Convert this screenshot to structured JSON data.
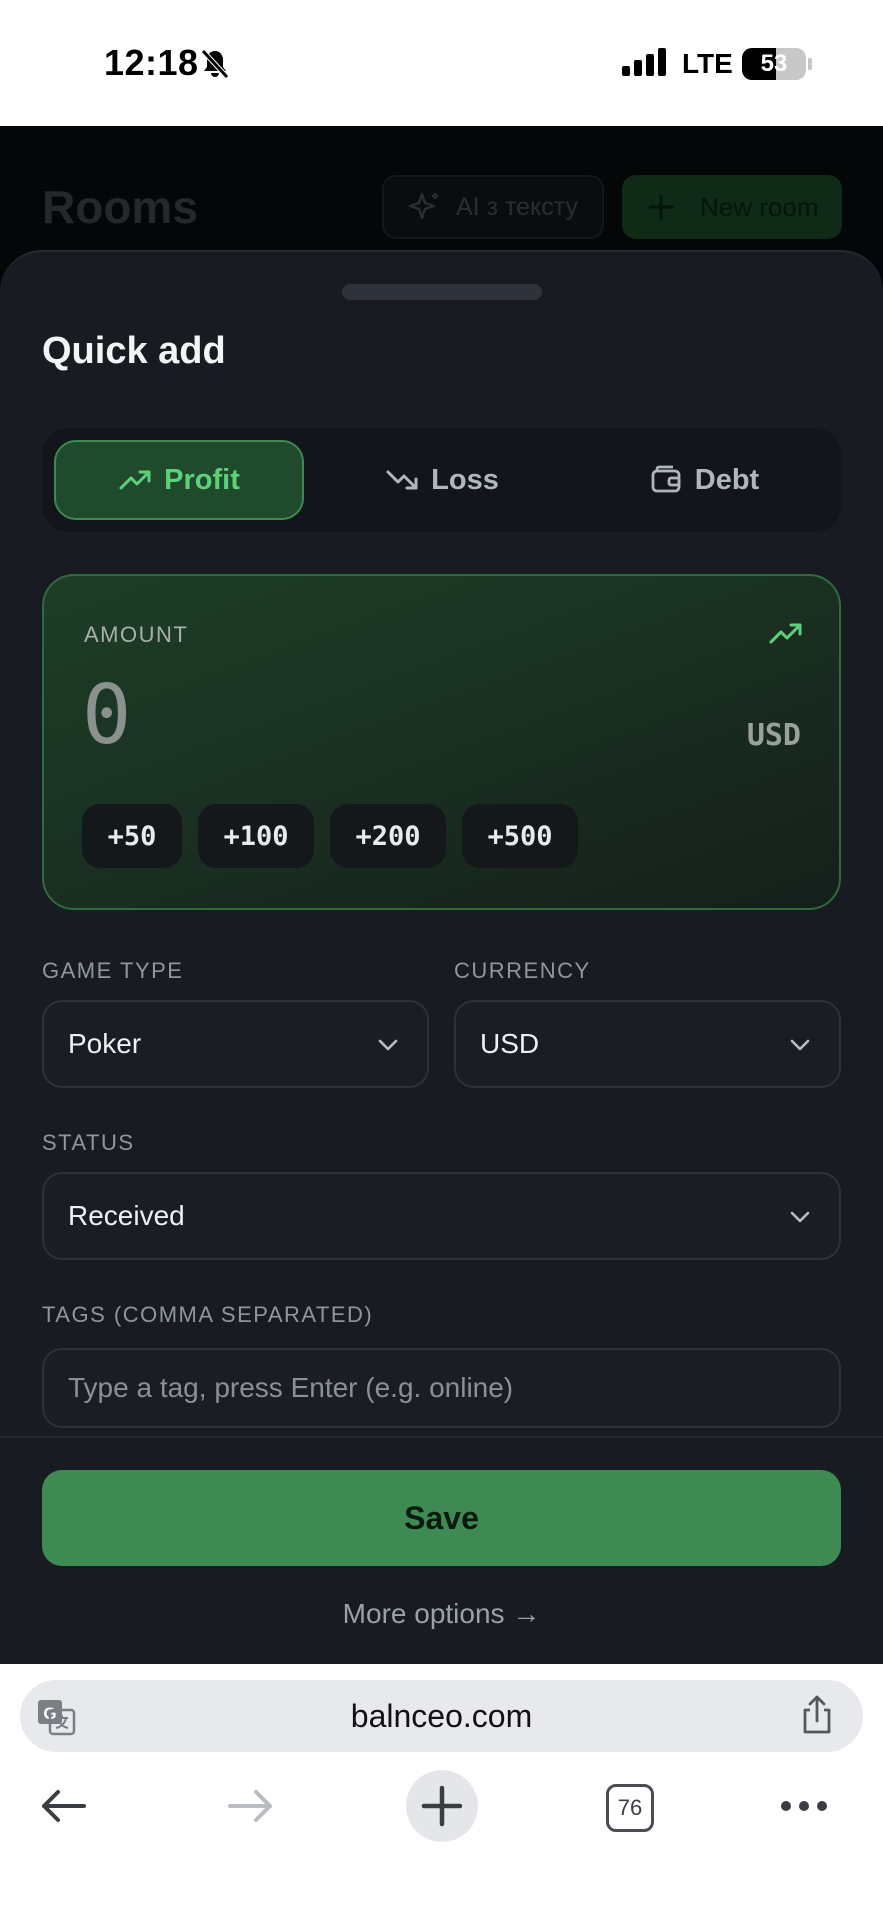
{
  "status_bar": {
    "time": "12:18",
    "network": "LTE",
    "battery": "53",
    "battery_level": 0.53
  },
  "background": {
    "title": "Rooms",
    "ai_button_label": "AI з тексту",
    "new_room_label": "New room"
  },
  "sheet": {
    "title": "Quick add",
    "tabs": [
      {
        "label": "Profit",
        "icon": "trending-up-icon",
        "active": true
      },
      {
        "label": "Loss",
        "icon": "trending-down-icon",
        "active": false
      },
      {
        "label": "Debt",
        "icon": "wallet-icon",
        "active": false
      }
    ],
    "amount": {
      "label": "AMOUNT",
      "value": "0",
      "currency": "USD",
      "quick_chips": [
        "+50",
        "+100",
        "+200",
        "+500"
      ]
    },
    "game_type": {
      "label": "GAME TYPE",
      "value": "Poker"
    },
    "currency": {
      "label": "CURRENCY",
      "value": "USD"
    },
    "status": {
      "label": "STATUS",
      "value": "Received"
    },
    "tags": {
      "label": "TAGS (COMMA SEPARATED)",
      "placeholder": "Type a tag, press Enter (e.g. online)",
      "value": ""
    },
    "save_label": "Save",
    "more_options_label": "More options →"
  },
  "browser": {
    "url": "balnceo.com",
    "tab_count": "76"
  },
  "colors": {
    "accent_green": "#3e8a52",
    "profit_text": "#5fd07a",
    "sheet_bg": "#181c22"
  }
}
